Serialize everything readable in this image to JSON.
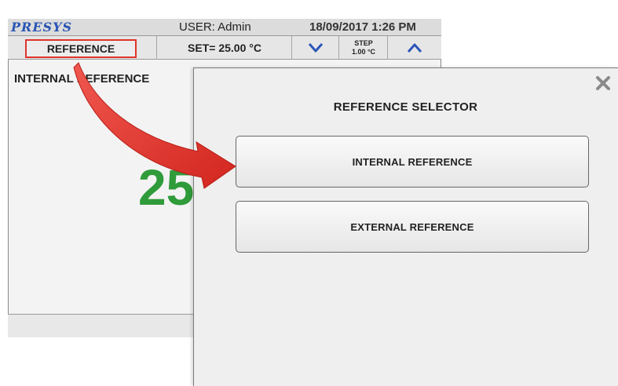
{
  "header": {
    "logo": "PRESYS",
    "user": "USER: Admin",
    "datetime": "18/09/2017  1:26 PM"
  },
  "toolbar": {
    "reference_label": "REFERENCE",
    "setpoint_label": "SET= 25.00 °C",
    "step_title": "STEP",
    "step_value": "1.00 °C",
    "down_icon": "chevron-down-icon",
    "up_icon": "chevron-up-icon"
  },
  "main": {
    "reference_mode": "INTERNAL REFERENCE",
    "reading": "25"
  },
  "dialog": {
    "title": "REFERENCE SELECTOR",
    "options": [
      {
        "label": "INTERNAL REFERENCE"
      },
      {
        "label": "EXTERNAL REFERENCE"
      }
    ],
    "close_icon": "close-icon"
  },
  "colors": {
    "logo": "#2a55b4",
    "highlight": "#e0322b",
    "reading": "#2f9b3a",
    "arrow": "#e0322b",
    "chevron": "#2c56b8"
  }
}
